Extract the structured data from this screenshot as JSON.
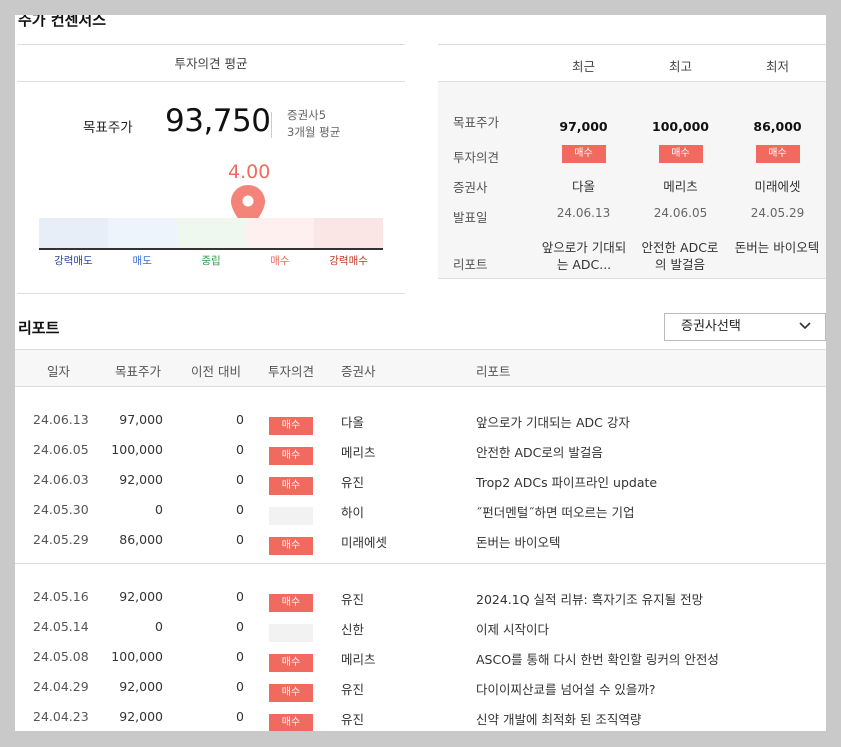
{
  "consensus": {
    "title": "주가 컨센서스",
    "panel_title": "투자의견 평균",
    "target_label": "목표주가",
    "target_value": "93,750",
    "sub_line1": "증권사5",
    "sub_line2": "3개월 평균",
    "score": "4.00",
    "gauge": {
      "value": 4.0,
      "segments": [
        {
          "label": "강력매도",
          "color": "#e8eef8",
          "text_color": "#2a4a9a"
        },
        {
          "label": "매도",
          "color": "#eef4fc",
          "text_color": "#3b6fd6"
        },
        {
          "label": "중립",
          "color": "#eef8ee",
          "text_color": "#3a9a4a"
        },
        {
          "label": "매수",
          "color": "#fdf0ef",
          "text_color": "#f06a5f"
        },
        {
          "label": "강력매수",
          "color": "#fbe6e6",
          "text_color": "#c0392b"
        }
      ]
    }
  },
  "summary": {
    "columns": [
      "최근",
      "최고",
      "최저"
    ],
    "row_labels": [
      "목표주가",
      "투자의견",
      "증권사",
      "발표일",
      "리포트"
    ],
    "cols": [
      {
        "target": "97,000",
        "opinion": "매수",
        "broker": "다올",
        "date": "24.06.13",
        "report": "앞으로가 기대되는 ADC..."
      },
      {
        "target": "100,000",
        "opinion": "매수",
        "broker": "메리츠",
        "date": "24.06.05",
        "report": "안전한 ADC로의 발걸음"
      },
      {
        "target": "86,000",
        "opinion": "매수",
        "broker": "미래에셋",
        "date": "24.05.29",
        "report": "돈버는 바이오텍"
      }
    ]
  },
  "reports": {
    "title": "리포트",
    "select_label": "증권사선택",
    "headers": [
      "일자",
      "목표주가",
      "이전 대비",
      "투자의견",
      "증권사",
      "리포트"
    ],
    "rows": [
      {
        "date": "24.06.13",
        "target": "97,000",
        "change": "0",
        "opinion": "매수",
        "broker": "다올",
        "report": "앞으로가 기대되는 ADC 강자"
      },
      {
        "date": "24.06.05",
        "target": "100,000",
        "change": "0",
        "opinion": "매수",
        "broker": "메리츠",
        "report": "안전한 ADC로의 발걸음"
      },
      {
        "date": "24.06.03",
        "target": "92,000",
        "change": "0",
        "opinion": "매수",
        "broker": "유진",
        "report": "Trop2 ADCs 파이프라인 update"
      },
      {
        "date": "24.05.30",
        "target": "0",
        "change": "0",
        "opinion": "",
        "broker": "하이",
        "report": "˝펀더멘털˝하면 떠오르는 기업"
      },
      {
        "date": "24.05.29",
        "target": "86,000",
        "change": "0",
        "opinion": "매수",
        "broker": "미래에셋",
        "report": "돈버는 바이오텍"
      },
      {
        "date": "24.05.16",
        "target": "92,000",
        "change": "0",
        "opinion": "매수",
        "broker": "유진",
        "report": "2024.1Q 실적 리뷰: 흑자기조 유지될 전망"
      },
      {
        "date": "24.05.14",
        "target": "0",
        "change": "0",
        "opinion": "",
        "broker": "신한",
        "report": "이제 시작이다"
      },
      {
        "date": "24.05.08",
        "target": "100,000",
        "change": "0",
        "opinion": "매수",
        "broker": "메리츠",
        "report": "ASCO를 통해 다시 한번 확인할 링커의 안전성"
      },
      {
        "date": "24.04.29",
        "target": "92,000",
        "change": "0",
        "opinion": "매수",
        "broker": "유진",
        "report": "다이이찌산쿄를 넘어설 수 있을까?"
      },
      {
        "date": "24.04.23",
        "target": "92,000",
        "change": "0",
        "opinion": "매수",
        "broker": "유진",
        "report": "신약 개발에 최적화 된 조직역량"
      }
    ]
  }
}
